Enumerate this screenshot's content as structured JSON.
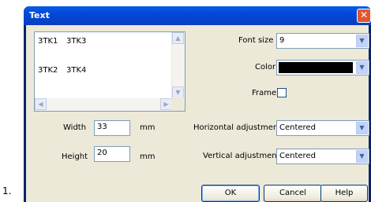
{
  "list_number": "1.",
  "dialog": {
    "title": "Text",
    "close_glyph": "✕"
  },
  "listbox": {
    "rows": [
      [
        "3TK1",
        "3TK3"
      ],
      [
        "3TK2",
        "3TK4"
      ]
    ]
  },
  "width": {
    "label": "Width",
    "value": "33",
    "unit": "mm"
  },
  "height": {
    "label": "Height",
    "value": "20",
    "unit": "mm"
  },
  "font_size": {
    "label": "Font size",
    "value": "9"
  },
  "color": {
    "label": "Color",
    "value": "#000000"
  },
  "frame": {
    "label": "Frame",
    "checked": false
  },
  "horizontal_adjustment": {
    "label": "Horizontal adjustment",
    "value": "Centered"
  },
  "vertical_adjustment": {
    "label": "Vertical adjustment",
    "value": "Centered"
  },
  "buttons": {
    "ok": "OK",
    "cancel": "Cancel",
    "help": "Help"
  },
  "icons": {
    "scroll_up": "▲",
    "scroll_down": "▼",
    "scroll_left": "◀",
    "scroll_right": "▶",
    "dropdown": "▼"
  }
}
